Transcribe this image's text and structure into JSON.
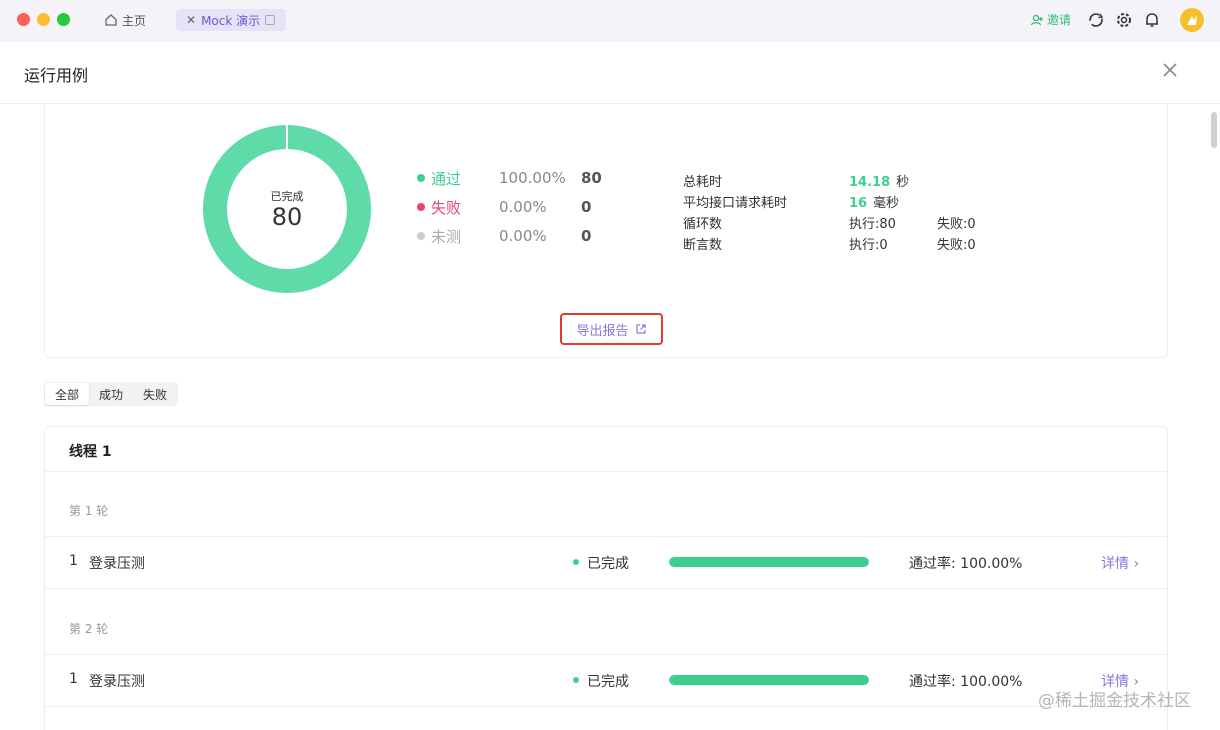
{
  "titlebar": {
    "tabs": [
      {
        "label": "主页",
        "icon": "home-icon"
      },
      {
        "label": "Mock 演示",
        "icon": "close-icon"
      }
    ],
    "invite_label": "邀请",
    "icons": [
      "sync-icon",
      "gear-icon",
      "bell-icon",
      "avatar"
    ]
  },
  "header": {
    "title": "运行用例",
    "close_icon": "close-icon"
  },
  "summary": {
    "donut_label": "已完成",
    "donut_value": "80",
    "donut_fill_fraction": 1.0,
    "legend": [
      {
        "name": "通过",
        "pct": "100.00%",
        "count": "80",
        "color": "#3ccf8e"
      },
      {
        "name": "失败",
        "pct": "0.00%",
        "count": "0",
        "color": "#e5486d"
      },
      {
        "name": "未测",
        "pct": "0.00%",
        "count": "0",
        "color": "#cccccc"
      }
    ],
    "stats": {
      "total_time_label": "总耗时",
      "total_time_value": "14.18",
      "total_time_unit": "秒",
      "avg_label": "平均接口请求耗时",
      "avg_value": "16",
      "avg_unit": "毫秒",
      "loop_label": "循环数",
      "loop_exec": "执行:80",
      "loop_fail": "失败:0",
      "assert_label": "断言数",
      "assert_exec": "执行:0",
      "assert_fail": "失败:0"
    },
    "export_label": "导出报告"
  },
  "filters": [
    "全部",
    "成功",
    "失败"
  ],
  "thread": {
    "title": "线程 1",
    "rounds": [
      {
        "label": "第 1 轮",
        "row": {
          "index": "1",
          "name": "登录压测",
          "status": "已完成",
          "progress": 1.0,
          "rate": "通过率: 100.00%",
          "detail": "详情 ›"
        }
      },
      {
        "label": "第 2 轮",
        "row": {
          "index": "1",
          "name": "登录压测",
          "status": "已完成",
          "progress": 1.0,
          "rate": "通过率: 100.00%",
          "detail": "详情 ›"
        }
      }
    ]
  },
  "watermark": "@稀土掘金技术社区",
  "colors": {
    "accent": "#8a73e0",
    "success": "#3ccf8e",
    "invite": "#2dbb76",
    "highlight_border": "#e03a2b"
  }
}
